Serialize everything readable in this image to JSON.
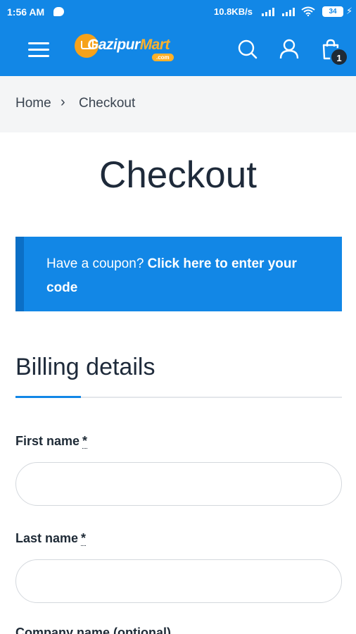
{
  "status_bar": {
    "time": "1:56 AM",
    "net_speed": "10.8KB/s",
    "battery": "34"
  },
  "header": {
    "logo_text_main": "Gazipur",
    "logo_text_accent": "Mart",
    "logo_suffix": ".com",
    "cart_count": "1",
    "brand_color": "#1287e6",
    "accent_color": "#ffb12a"
  },
  "breadcrumb": {
    "home": "Home",
    "separator": "›",
    "current": "Checkout"
  },
  "page": {
    "title": "Checkout"
  },
  "coupon": {
    "prefix": "Have a coupon? ",
    "link_text": "Click here to enter your code"
  },
  "billing": {
    "title": "Billing details",
    "fields": [
      {
        "label": "First name",
        "required_mark": "*",
        "value": ""
      },
      {
        "label": "Last name",
        "required_mark": "*",
        "value": ""
      },
      {
        "label": "Company name (optional)"
      }
    ]
  }
}
